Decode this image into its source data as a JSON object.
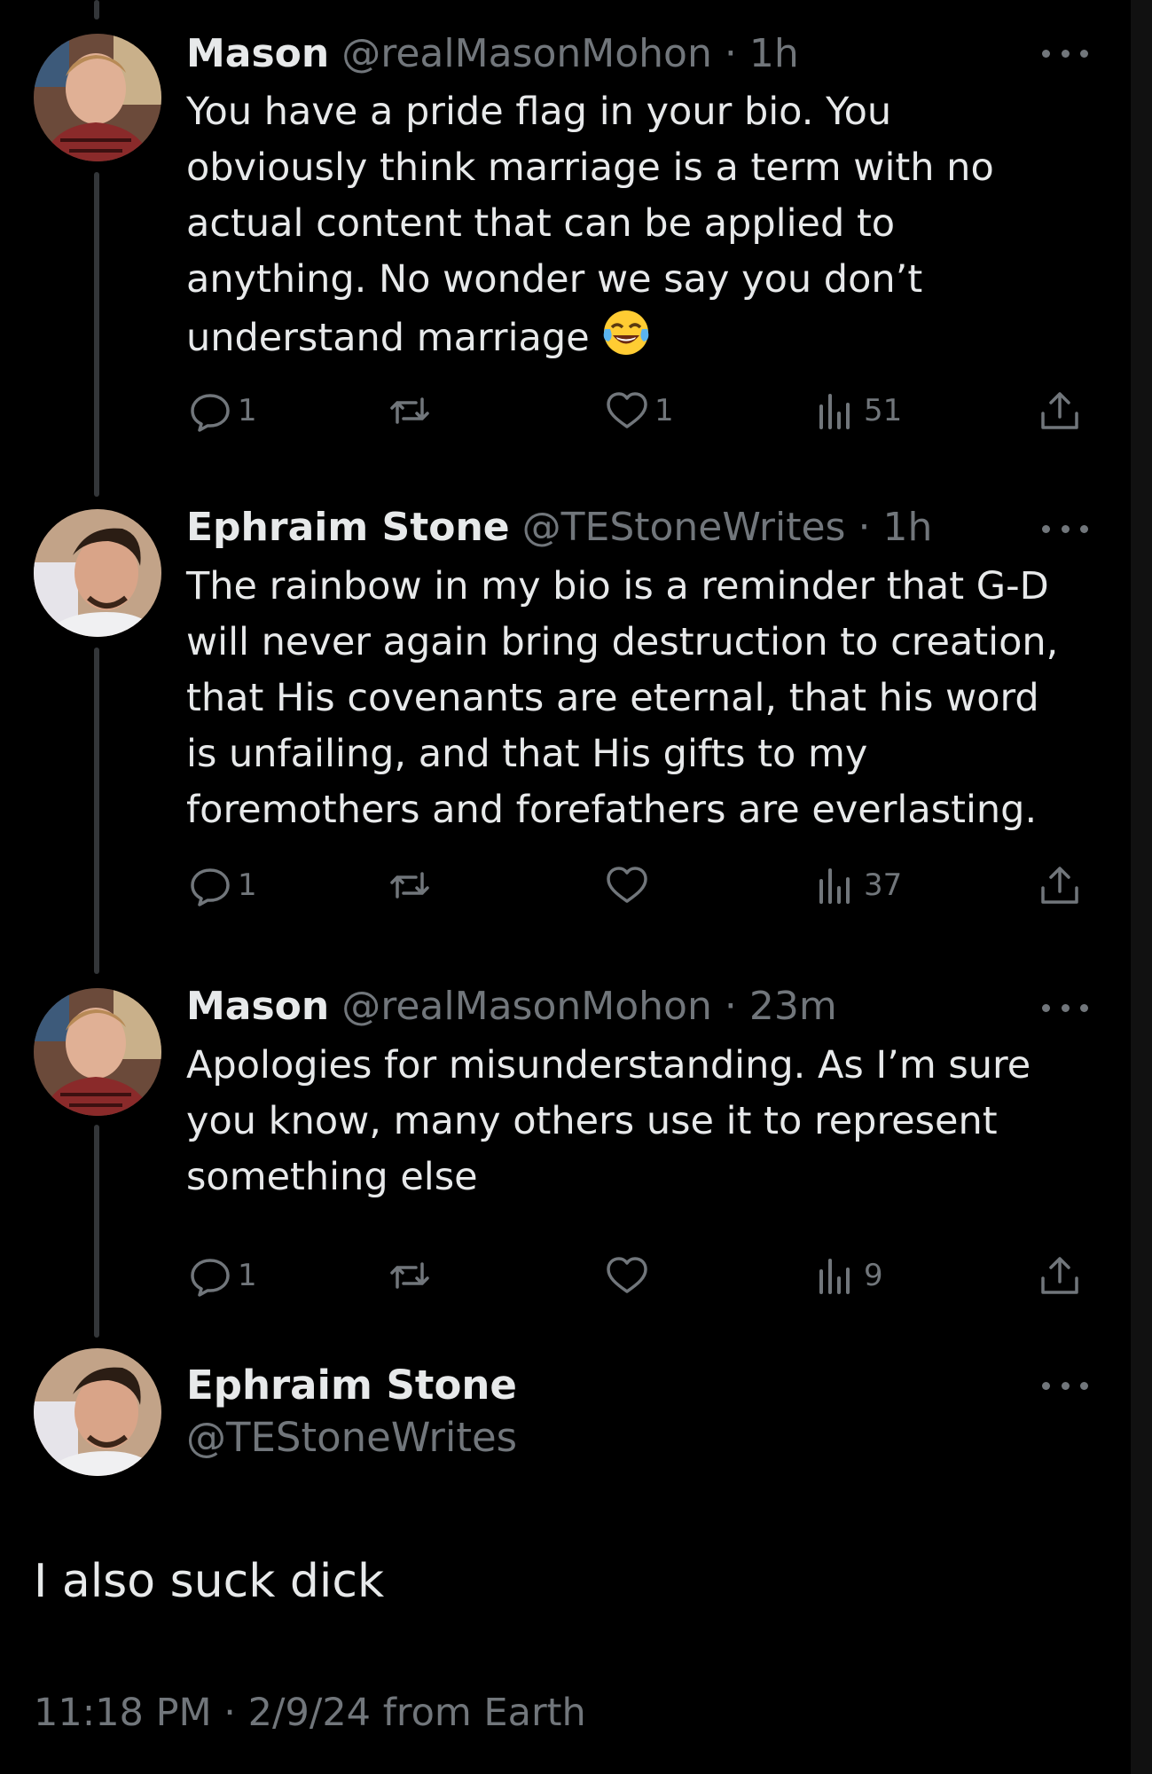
{
  "tweets": [
    {
      "name": "Mason",
      "handle": "@realMasonMohon",
      "separator": "·",
      "time": "1h",
      "text": "You have a pride flag in your bio. You\nobviously think marriage is a term with no\nactual content that can be applied to\nanything. No wonder we say you don’t\nunderstand marriage",
      "emoji": "tears-of-joy-emoji",
      "replies": "1",
      "reposts": "",
      "likes": "1",
      "views": "51"
    },
    {
      "name": "Ephraim Stone",
      "handle": "@TEStoneWrites",
      "separator": "·",
      "time": "1h",
      "text": "The rainbow in my  bio is a reminder that G-D\nwill never again bring destruction to creation,\nthat His covenants are eternal, that his word\nis unfailing, and that His gifts to my\nforemothers and forefathers are everlasting.",
      "replies": "1",
      "reposts": "",
      "likes": "",
      "views": "37"
    },
    {
      "name": "Mason",
      "handle": "@realMasonMohon",
      "separator": "·",
      "time": "23m",
      "text": "Apologies for misunderstanding. As I’m sure\nyou know, many others use it to represent\nsomething else",
      "replies": "1",
      "reposts": "",
      "likes": "",
      "views": "9"
    }
  ],
  "main_tweet": {
    "name": "Ephraim Stone",
    "handle": "@TEStoneWrites",
    "text": "I also suck dick",
    "footer": "11:18 PM · 2/9/24 from Earth"
  },
  "icons": {
    "reply": "reply-icon",
    "repost": "repost-icon",
    "like": "heart-icon",
    "views": "views-icon",
    "share": "share-icon",
    "more": "more-options-icon"
  },
  "colors": {
    "background": "#000000",
    "primary_text": "#e7e9ea",
    "secondary_text": "#71767b",
    "thread_line": "#333639"
  }
}
